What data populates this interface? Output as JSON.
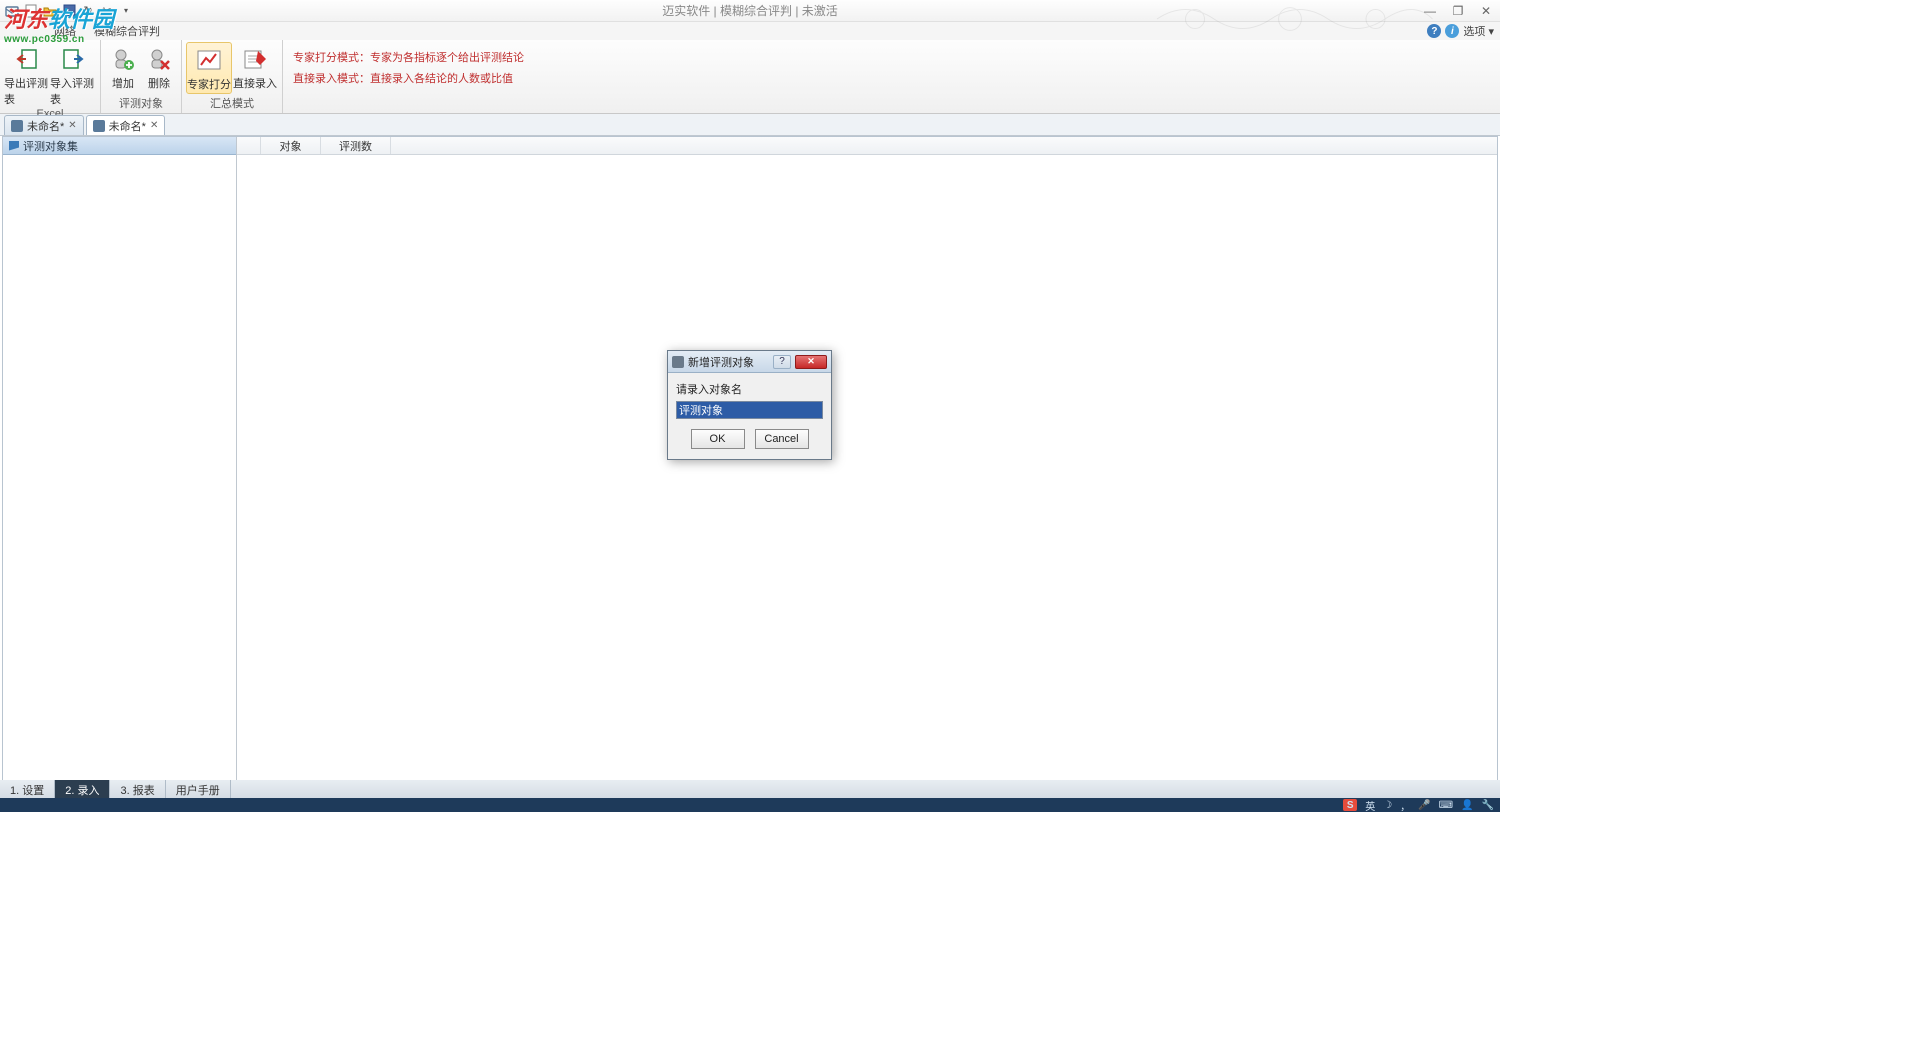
{
  "app_title": "迈实软件 | 模糊综合评判 | 未激活",
  "watermark": {
    "cn_prefix": "河东",
    "cn_suffix": "软件园",
    "url": "www.pc0359.cn"
  },
  "menurow": {
    "net": "网络",
    "m1": "模糊综合评判",
    "options": "选项 ▾"
  },
  "ribbon": {
    "export": "导出评测表",
    "import": "导入评测表",
    "g1_label": "Excel",
    "add": "增加",
    "del": "删除",
    "g2_label": "评测对象",
    "expert": "专家打分",
    "direct": "直接录入",
    "g3_label": "汇总模式",
    "text1": "专家打分模式：专家为各指标逐个给出评测结论",
    "text2": "直接录入模式：直接录入各结论的人数或比值"
  },
  "tabs": {
    "t1": "未命名*",
    "t2": "未命名*"
  },
  "tree": {
    "root": "评测对象集"
  },
  "grid": {
    "col1": "对象",
    "col2": "评测数"
  },
  "bottomtabs": {
    "t1": "1. 设置",
    "t2": "2. 录入",
    "t3": "3. 报表",
    "t4": "用户手册"
  },
  "modal": {
    "title": "新增评测对象",
    "label": "请录入对象名",
    "value": "评测对象",
    "ok": "OK",
    "cancel": "Cancel",
    "close": "✕",
    "help": "?"
  },
  "taskbar": {
    "ime": "英"
  }
}
